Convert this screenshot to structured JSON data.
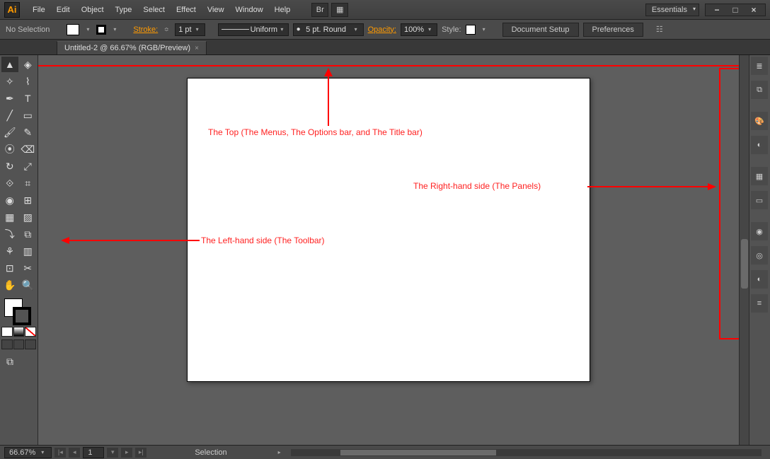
{
  "logo": "Ai",
  "menus": [
    "File",
    "Edit",
    "Object",
    "Type",
    "Select",
    "Effect",
    "View",
    "Window",
    "Help"
  ],
  "workspace": "Essentials",
  "options": {
    "selection": "No Selection",
    "stroke_label": "Stroke:",
    "stroke_val": "1 pt",
    "profile": "Uniform",
    "brush": "5 pt. Round",
    "opacity_label": "Opacity:",
    "opacity_val": "100%",
    "style_label": "Style:",
    "doc_setup": "Document Setup",
    "preferences": "Preferences"
  },
  "tab": {
    "title": "Untitled-2 @ 66.67% (RGB/Preview)",
    "close": "×"
  },
  "status": {
    "zoom": "66.67%",
    "page": "1",
    "tool": "Selection"
  },
  "annotations": {
    "top": "The Top (The Menus, The Options bar, and The Title bar)",
    "left": "The Left-hand side (The Toolbar)",
    "right": "The Right-hand side (The Panels)"
  }
}
